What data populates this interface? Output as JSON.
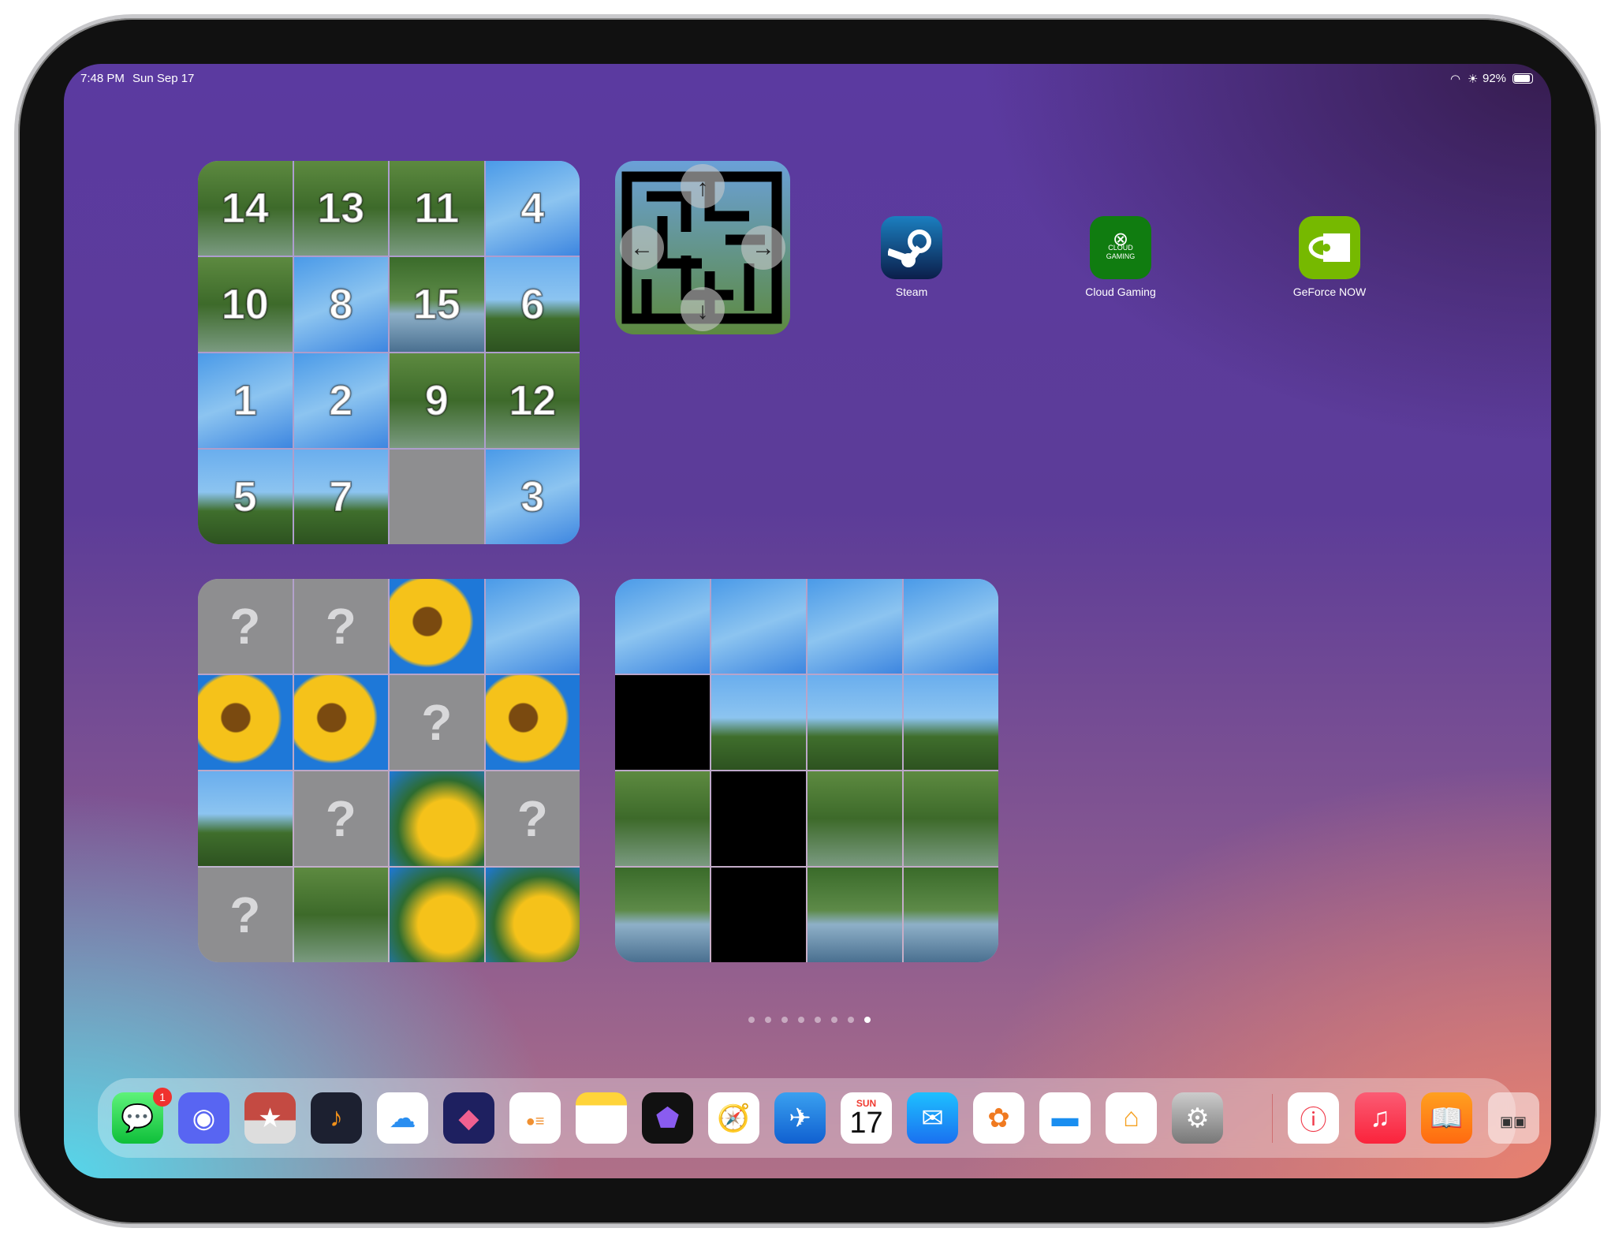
{
  "status_bar": {
    "time": "7:48 PM",
    "date": "Sun Sep 17",
    "battery": "92%",
    "battery_level": 0.92
  },
  "puzzle_widget": {
    "tiles": [
      "14",
      "13",
      "11",
      "4",
      "10",
      "8",
      "15",
      "6",
      "1",
      "2",
      "9",
      "12",
      "5",
      "7",
      "",
      "3"
    ]
  },
  "mystery_widget": {
    "tiles": [
      "?",
      "?",
      "",
      "",
      "",
      "",
      "?",
      "",
      "",
      "?",
      "",
      "?",
      "?",
      "",
      "",
      ""
    ]
  },
  "apps": [
    {
      "label": "Steam",
      "color": "#1a3a70"
    },
    {
      "label": "Cloud Gaming",
      "color": "#107c10",
      "icon_text": "CLOUD\nGAMING"
    },
    {
      "label": "GeForce NOW",
      "color": "#76b900"
    }
  ],
  "page_dots": {
    "count": 8,
    "active": 8
  },
  "dock": {
    "messages_badge": "1",
    "calendar_day": "SUN",
    "calendar_date": "17",
    "icons": [
      "messages",
      "discord",
      "red-cloud-star",
      "music-note-app",
      "cloud-app",
      "shortcuts",
      "reminders",
      "notes",
      "obsidian",
      "safari",
      "testflight",
      "calendar",
      "mail",
      "photos",
      "files",
      "home",
      "settings",
      "info-app",
      "music",
      "books",
      "app-library"
    ]
  }
}
